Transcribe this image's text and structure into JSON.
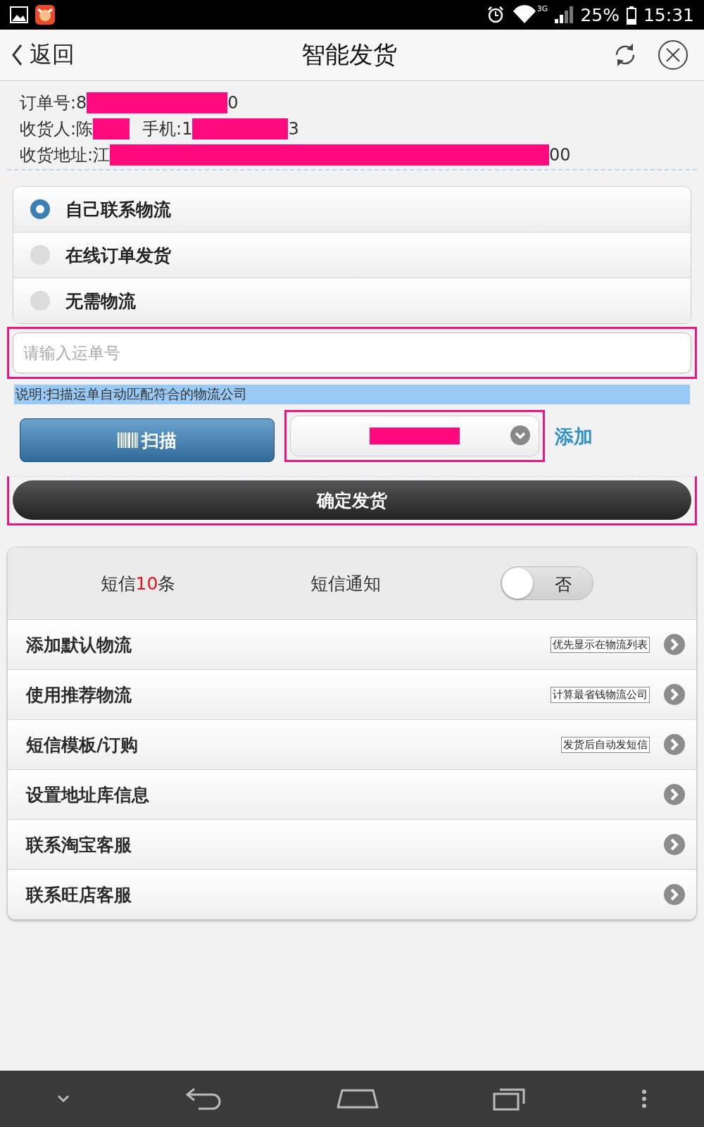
{
  "status_bar": {
    "network": "3G",
    "battery": "25%",
    "time": "15:31"
  },
  "header": {
    "back": "返回",
    "title": "智能发货"
  },
  "order_info": [
    {
      "parts": [
        {
          "kind": "text",
          "text": "订单号:8"
        },
        {
          "kind": "redaction"
        },
        {
          "kind": "text",
          "text": "0"
        }
      ]
    },
    {
      "parts": [
        {
          "kind": "text",
          "text": "收货人:陈"
        },
        {
          "kind": "redaction"
        },
        {
          "kind": "gap"
        },
        {
          "kind": "text",
          "text": "手机:1"
        },
        {
          "kind": "redaction"
        },
        {
          "kind": "text",
          "text": "3"
        }
      ]
    },
    {
      "parts": [
        {
          "kind": "text",
          "text": "收货地址:江"
        },
        {
          "kind": "redaction"
        },
        {
          "kind": "text",
          "text": "00"
        }
      ]
    }
  ],
  "logistics_options": [
    {
      "label": "自己联系物流",
      "selected": true
    },
    {
      "label": "在线订单发货",
      "selected": false
    },
    {
      "label": "无需物流",
      "selected": false
    }
  ],
  "waybill_field": {
    "placeholder": "请输入运单号",
    "highlighted": true
  },
  "note": "说明:扫描运单自动匹配符合的物流公司",
  "scan_button": "扫描",
  "carrier_select": {
    "value_redacted": true,
    "highlighted": true
  },
  "add_link": "添加",
  "confirm_button": {
    "label": "确定发货",
    "highlighted": true
  },
  "sms": {
    "prefix": "短信",
    "count": "10",
    "suffix": "条",
    "label": "短信通知",
    "toggle": {
      "on": false,
      "text": "否"
    }
  },
  "menu": [
    {
      "label": "添加默认物流",
      "tag": "优先显示在物流列表"
    },
    {
      "label": "使用推荐物流",
      "tag": "计算最省钱物流公司"
    },
    {
      "label": "短信模板/订购",
      "tag": "发货后自动发短信"
    },
    {
      "label": "设置地址库信息"
    },
    {
      "label": "联系淘宝客服"
    },
    {
      "label": "联系旺店客服"
    }
  ]
}
